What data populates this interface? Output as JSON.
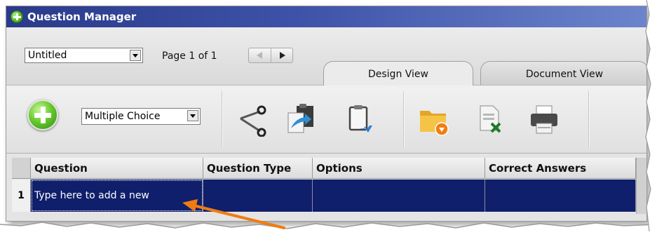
{
  "window": {
    "title": "Question Manager"
  },
  "topbar": {
    "document_select_value": "Untitled",
    "page_info": "Page 1 of 1",
    "tabs": [
      {
        "label": "Design View",
        "active": true
      },
      {
        "label": "Document View",
        "active": false
      }
    ]
  },
  "toolbar": {
    "question_type_value": "Multiple Choice",
    "icons": [
      "add-question-icon",
      "cut-icon",
      "copy-icon",
      "paste-icon",
      "import-folder-icon",
      "export-excel-icon",
      "print-icon"
    ]
  },
  "grid": {
    "columns": [
      "Question",
      "Question Type",
      "Options",
      "Correct Answers"
    ],
    "rows": [
      {
        "number": "1",
        "question": "Type here to add a new",
        "question_type": "",
        "options": "",
        "correct_answers": ""
      }
    ]
  },
  "colors": {
    "titlebar": "#3d52a8",
    "selected_row": "#0f1f6b",
    "annotation_arrow": "#f07c10"
  }
}
